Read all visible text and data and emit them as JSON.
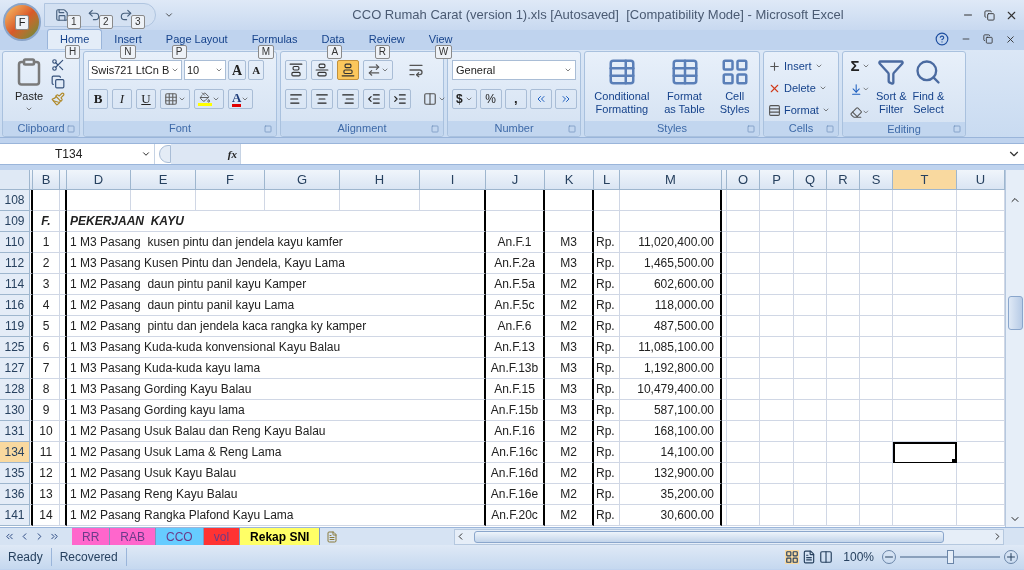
{
  "window": {
    "title": "CCO Rumah Carat (version 1).xls [Autosaved]  [Compatibility Mode] - Microsoft Excel"
  },
  "office_button": {
    "keytip": "F"
  },
  "quick_access": [
    {
      "kind": "save",
      "keytip": "1"
    },
    {
      "kind": "undo",
      "keytip": "2"
    },
    {
      "kind": "redo",
      "keytip": "3"
    }
  ],
  "tabs": [
    {
      "label": "Home",
      "keytip": "H",
      "selected": true
    },
    {
      "label": "Insert",
      "keytip": "N",
      "selected": false
    },
    {
      "label": "Page Layout",
      "keytip": "P",
      "selected": false
    },
    {
      "label": "Formulas",
      "keytip": "M",
      "selected": false
    },
    {
      "label": "Data",
      "keytip": "A",
      "selected": false
    },
    {
      "label": "Review",
      "keytip": "R",
      "selected": false
    },
    {
      "label": "View",
      "keytip": "W",
      "selected": false
    }
  ],
  "ribbon": {
    "clipboard": {
      "label": "Clipboard",
      "paste": "Paste"
    },
    "font": {
      "label": "Font",
      "font_name": "Swis721 LtCn B",
      "font_size": "10",
      "grow": "A",
      "shrink": "A",
      "bold": "B",
      "italic": "I",
      "underline": "U",
      "font_color": "A"
    },
    "alignment": {
      "label": "Alignment",
      "vertical": [
        {
          "selected": false
        },
        {
          "selected": false
        },
        {
          "selected": true
        }
      ]
    },
    "number": {
      "label": "Number",
      "format": "General",
      "currency": "$",
      "percent": "%",
      "comma": ","
    },
    "styles": {
      "label": "Styles",
      "buttons": [
        {
          "lines": [
            "Conditional",
            "Formatting"
          ]
        },
        {
          "lines": [
            "Format",
            "as Table"
          ]
        },
        {
          "lines": [
            "Cell",
            "Styles"
          ]
        }
      ]
    },
    "cells": {
      "label": "Cells",
      "buttons": [
        "Insert",
        "Delete",
        "Format"
      ]
    },
    "editing": {
      "label": "Editing",
      "sum": "Σ",
      "buttons": [
        {
          "lines": [
            "Sort &",
            "Filter"
          ]
        },
        {
          "lines": [
            "Find &",
            "Select"
          ]
        }
      ]
    }
  },
  "name_box": "T134",
  "formula_icon": "fx",
  "columns": [
    {
      "selected": false
    },
    {
      "label": "B",
      "selected": false
    },
    {
      "selected": false
    },
    {
      "label": "D",
      "selected": false
    },
    {
      "label": "E",
      "selected": false
    },
    {
      "label": "F",
      "selected": false
    },
    {
      "label": "G",
      "selected": false
    },
    {
      "label": "H",
      "selected": false
    },
    {
      "label": "I",
      "selected": false
    },
    {
      "label": "J",
      "selected": false
    },
    {
      "label": "K",
      "selected": false
    },
    {
      "label": "L",
      "selected": false
    },
    {
      "label": "M",
      "selected": false
    },
    {
      "selected": false
    },
    {
      "label": "O",
      "selected": false
    },
    {
      "label": "P",
      "selected": false
    },
    {
      "label": "Q",
      "selected": false
    },
    {
      "label": "R",
      "selected": false
    },
    {
      "label": "S",
      "selected": false
    },
    {
      "label": "T",
      "selected": true
    },
    {
      "label": "U",
      "selected": false
    }
  ],
  "rows": [
    {
      "row": "108",
      "selected": false
    },
    {
      "row": "109",
      "kind": "heading",
      "b": "F.",
      "d": "PEKERJAAN  KAYU",
      "selected": false
    },
    {
      "row": "110",
      "b": "1",
      "d": "1 M3 Pasang  kusen pintu dan jendela kayu kamfer",
      "j": "An.F.1",
      "k": "M3",
      "l": "Rp.",
      "m": "11,020,400.00",
      "selected": false
    },
    {
      "row": "112",
      "b": "2",
      "d": "1 M3 Pasang Kusen Pintu dan Jendela, Kayu Lama",
      "j": "An.F.2a",
      "k": "M3",
      "l": "Rp.",
      "m": "1,465,500.00",
      "selected": false
    },
    {
      "row": "114",
      "b": "3",
      "d": "1 M2 Pasang  daun pintu panil kayu Kamper",
      "j": "An.F.5a",
      "k": "M2",
      "l": "Rp.",
      "m": "602,600.00",
      "selected": false
    },
    {
      "row": "116",
      "b": "4",
      "d": "1 M2 Pasang  daun pintu panil kayu Lama",
      "j": "An.F.5c",
      "k": "M2",
      "l": "Rp.",
      "m": "118,000.00",
      "selected": false
    },
    {
      "row": "119",
      "b": "5",
      "d": "1 M2 Pasang  pintu dan jendela kaca rangka ky kamper",
      "j": "An.F.6",
      "k": "M2",
      "l": "Rp.",
      "m": "487,500.00",
      "selected": false
    },
    {
      "row": "125",
      "b": "6",
      "d": "1 M3 Pasang Kuda-kuda konvensional Kayu Balau",
      "j": "An.F.13",
      "k": "M3",
      "l": "Rp.",
      "m": "11,085,100.00",
      "selected": false
    },
    {
      "row": "127",
      "b": "7",
      "d": "1 M3 Pasang Kuda-kuda kayu lama",
      "j": "An.F.13b",
      "k": "M3",
      "l": "Rp.",
      "m": "1,192,800.00",
      "selected": false
    },
    {
      "row": "128",
      "b": "8",
      "d": "1 M3 Pasang Gording Kayu Balau",
      "j": "An.F.15",
      "k": "M3",
      "l": "Rp.",
      "m": "10,479,400.00",
      "selected": false
    },
    {
      "row": "130",
      "b": "9",
      "d": "1 M3 Pasang Gording kayu lama",
      "j": "An.F.15b",
      "k": "M3",
      "l": "Rp.",
      "m": "587,100.00",
      "selected": false
    },
    {
      "row": "131",
      "b": "10",
      "d": "1 M2 Pasang Usuk Balau dan Reng Kayu Balau",
      "j": "An.F.16",
      "k": "M2",
      "l": "Rp.",
      "m": "168,100.00",
      "selected": false
    },
    {
      "row": "134",
      "b": "11",
      "d": "1 M2 Pasang Usuk Lama & Reng Lama",
      "j": "An.F.16c",
      "k": "M2",
      "l": "Rp.",
      "m": "14,100.00",
      "selected": true
    },
    {
      "row": "135",
      "b": "12",
      "d": "1 M2 Pasang Usuk Kayu Balau",
      "j": "An.F.16d",
      "k": "M2",
      "l": "Rp.",
      "m": "132,900.00",
      "selected": false
    },
    {
      "row": "136",
      "b": "13",
      "d": "1 M2 Pasang Reng Kayu Balau",
      "j": "An.F.16e",
      "k": "M2",
      "l": "Rp.",
      "m": "35,200.00",
      "selected": false
    },
    {
      "row": "141",
      "b": "14",
      "d": "1 M2 Pasang Rangka Plafond Kayu Lama",
      "j": "An.F.20c",
      "k": "M2",
      "l": "Rp.",
      "m": "30,600.00",
      "selected": false
    }
  ],
  "sheet_tabs": [
    {
      "label": "RR",
      "color": "#ff66cc",
      "selected": false
    },
    {
      "label": "RAB",
      "color": "#ff66cc",
      "selected": false
    },
    {
      "label": "CCO",
      "color": "#66ccff",
      "selected": false
    },
    {
      "label": "vol",
      "color": "#ff3333",
      "selected": false
    },
    {
      "label": "Rekap SNI",
      "color": "#ffff66",
      "selected": true
    }
  ],
  "status_bar": {
    "state": "Ready",
    "recovery": "Recovered",
    "zoom": "100%",
    "level": 0.5
  }
}
